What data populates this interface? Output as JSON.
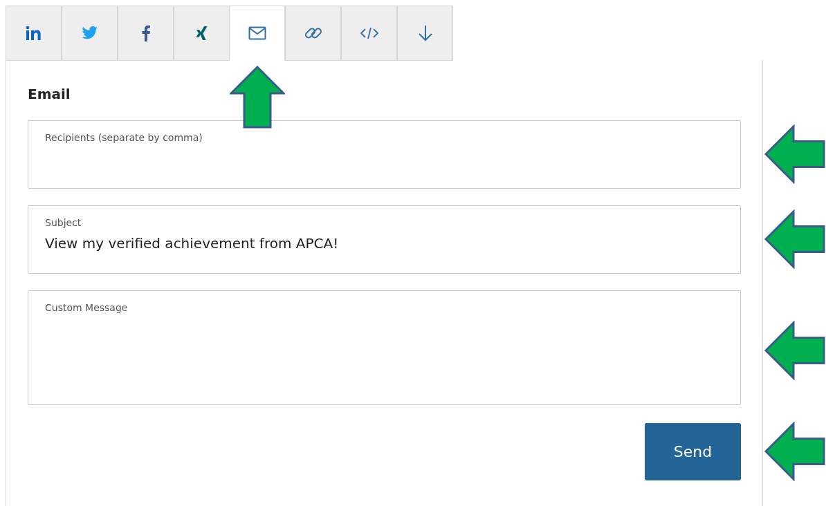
{
  "tabs": [
    {
      "kind": "linkedin",
      "selected": false,
      "pointed": false
    },
    {
      "kind": "twitter",
      "selected": false,
      "pointed": false
    },
    {
      "kind": "facebook",
      "selected": false,
      "pointed": false
    },
    {
      "kind": "xing",
      "selected": false,
      "pointed": false
    },
    {
      "kind": "email",
      "selected": true,
      "pointed": true
    },
    {
      "kind": "link",
      "selected": false,
      "pointed": false
    },
    {
      "kind": "embed",
      "selected": false,
      "pointed": false
    },
    {
      "kind": "download",
      "selected": false,
      "pointed": false
    }
  ],
  "panel": {
    "title": "Email",
    "fields": [
      {
        "kind": "line",
        "label": "Recipients (separate by comma)",
        "pointed": true
      },
      {
        "kind": "line",
        "label": "Subject",
        "value": "View my verified achievement from APCA!",
        "pointed": true
      },
      {
        "kind": "area",
        "label": "Custom Message",
        "pointed": true
      }
    ],
    "button": {
      "label": "Send",
      "pointed": true
    }
  }
}
